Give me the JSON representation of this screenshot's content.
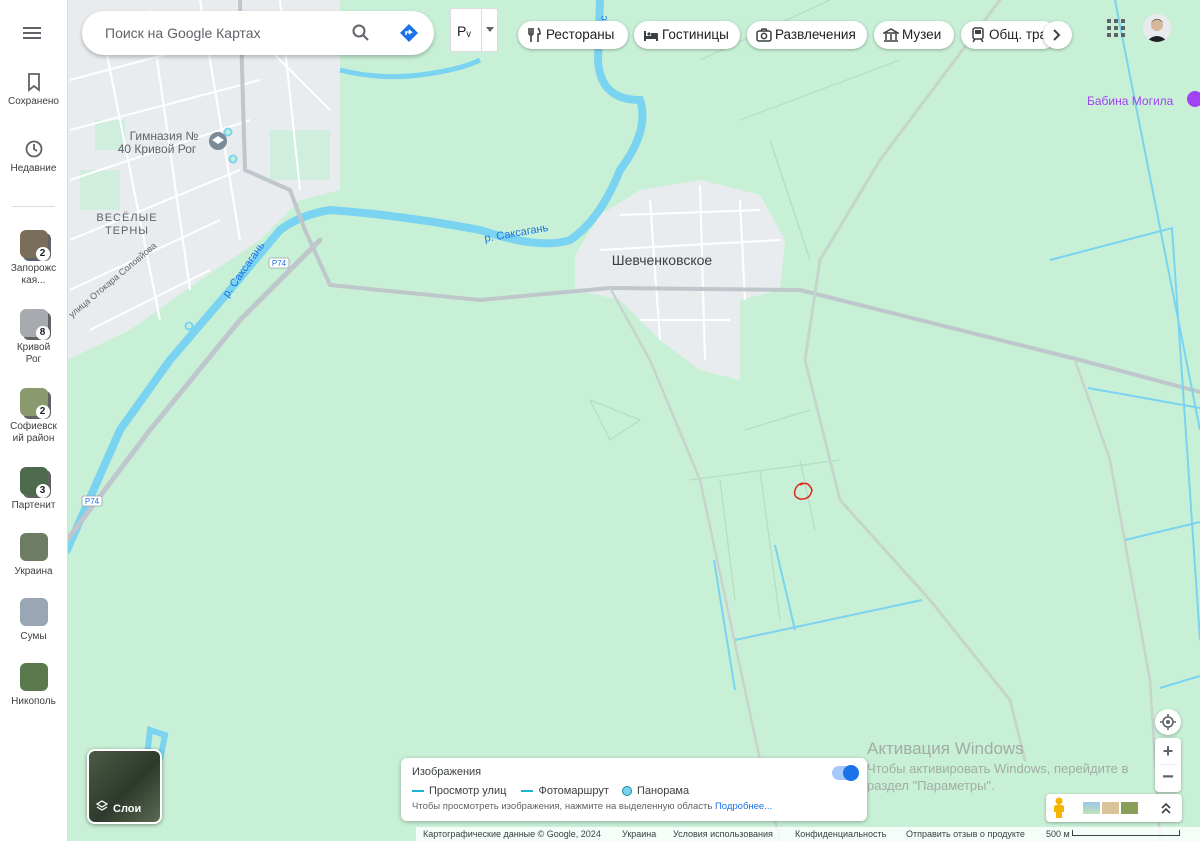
{
  "search": {
    "placeholder": "Поиск на Google Картах"
  },
  "language": {
    "label": "Рᵥ"
  },
  "chips": [
    {
      "icon": "restaurant-icon",
      "label": "Рестораны"
    },
    {
      "icon": "hotel-icon",
      "label": "Гостиницы"
    },
    {
      "icon": "camera-icon",
      "label": "Развлечения"
    },
    {
      "icon": "museum-icon",
      "label": "Музеи"
    },
    {
      "icon": "train-icon",
      "label": "Общ. тра"
    }
  ],
  "sidebar": {
    "saved_label": "Сохранено",
    "recent_label": "Недавние",
    "recent_items": [
      {
        "label": "Запорожс кая...",
        "count": "2",
        "color": "#7a6e5a"
      },
      {
        "label": "Кривой Рог",
        "count": "8",
        "color": "#a7abb0"
      },
      {
        "label": "Софиевск ий район",
        "count": "2",
        "color": "#8a9a6e"
      },
      {
        "label": "Партенит",
        "count": "3",
        "color": "#4e6a4c"
      },
      {
        "label": "Украина",
        "count": "",
        "color": "#6d7d64"
      },
      {
        "label": "Сумы",
        "count": "",
        "color": "#9aa6b4"
      },
      {
        "label": "Никополь",
        "count": "",
        "color": "#5a7a4e"
      }
    ]
  },
  "layers": {
    "label": "Слои"
  },
  "imagery": {
    "title": "Изображения",
    "legend": [
      "Просмотр улиц",
      "Фотомаршрут",
      "Панорама"
    ],
    "hint": "Чтобы просмотреть изображения, нажмите на выделенную область",
    "more": "Подробнее...",
    "enabled": true
  },
  "footer": {
    "items": [
      "Картографические данные © Google, 2024",
      "Украина",
      "Условия использования",
      "Конфиденциальность",
      "Отправить отзыв о продукте",
      "500 м"
    ]
  },
  "watermark": {
    "title": "Активация Windows",
    "line1": "Чтобы активировать Windows, перейдите в",
    "line2": "раздел \"Параметры\"."
  },
  "chart_data": {
    "type": "map",
    "places": [
      {
        "name": "Шевченковское",
        "kind": "village"
      },
      {
        "name": "ВЕСЁЛЫЕ ТЕРНЫ",
        "kind": "district"
      },
      {
        "name": "Гимназия № 40 Кривой Рог",
        "kind": "school"
      },
      {
        "name": "Бабина Могила",
        "kind": "landmark"
      }
    ],
    "road_labels": [
      "Р74",
      "Р74"
    ],
    "river_labels": [
      "р. Саксагань",
      "р. Саксагань",
      "Сакс"
    ],
    "street_labels": [
      "улица Отокара Соловйова"
    ],
    "colors": {
      "land": "#c8f0d6",
      "settlement": "#e9ecef",
      "water": "#7ad3f0",
      "road": "#bfc6cc"
    }
  }
}
